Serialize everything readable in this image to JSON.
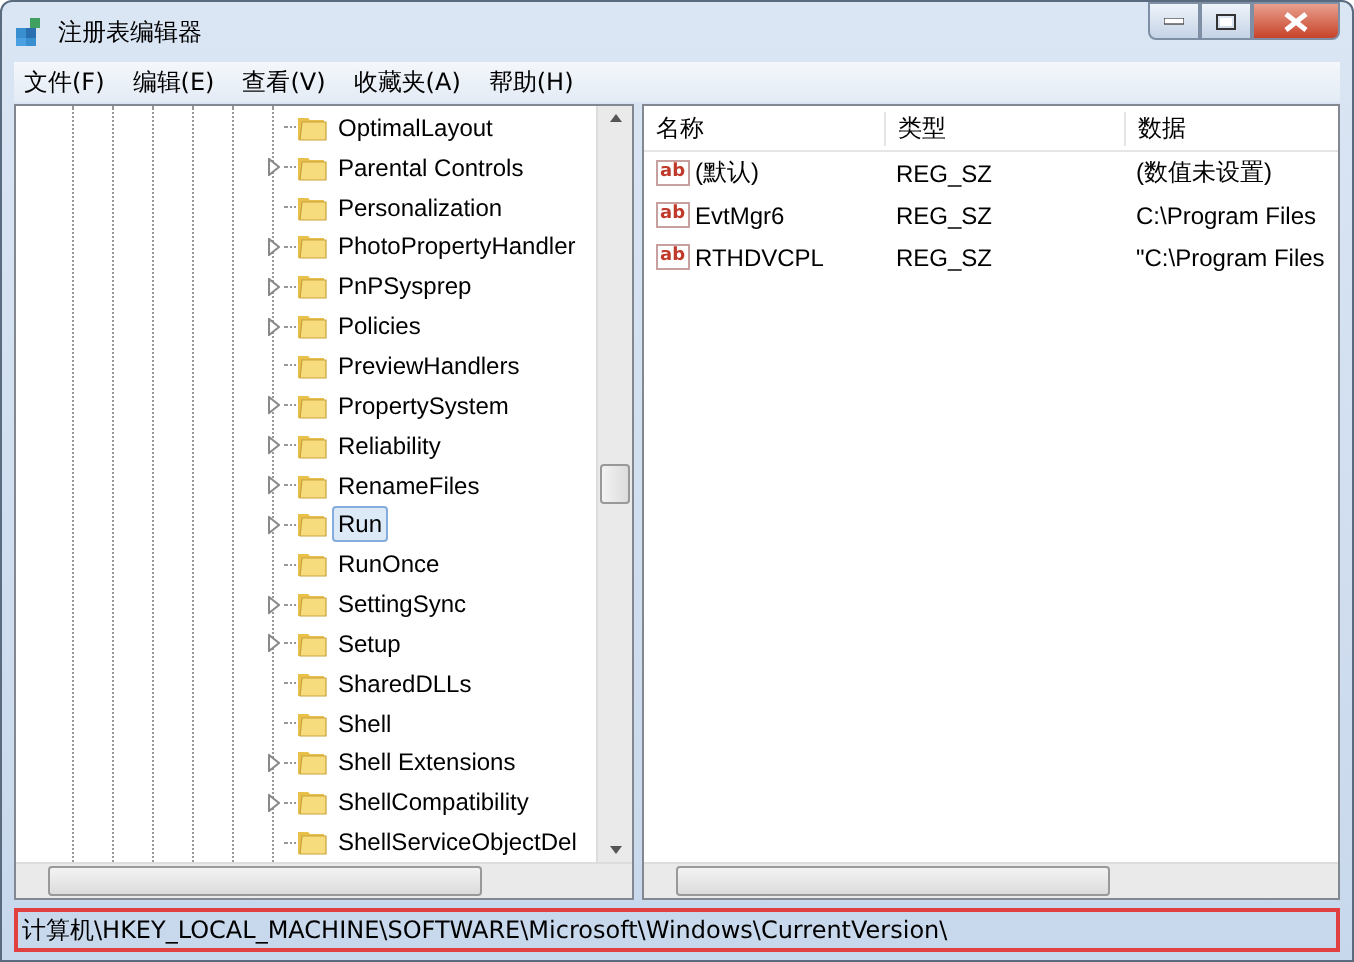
{
  "window": {
    "title": "注册表编辑器"
  },
  "menu": [
    "文件(F)",
    "编辑(E)",
    "查看(V)",
    "收藏夹(A)",
    "帮助(H)"
  ],
  "tree": {
    "items": [
      {
        "label": "OptimalLayout",
        "has_children": false,
        "selected": false
      },
      {
        "label": "Parental Controls",
        "has_children": true,
        "selected": false
      },
      {
        "label": "Personalization",
        "has_children": false,
        "selected": false
      },
      {
        "label": "PhotoPropertyHandler",
        "has_children": true,
        "selected": false
      },
      {
        "label": "PnPSysprep",
        "has_children": true,
        "selected": false
      },
      {
        "label": "Policies",
        "has_children": true,
        "selected": false
      },
      {
        "label": "PreviewHandlers",
        "has_children": false,
        "selected": false
      },
      {
        "label": "PropertySystem",
        "has_children": true,
        "selected": false
      },
      {
        "label": "Reliability",
        "has_children": true,
        "selected": false
      },
      {
        "label": "RenameFiles",
        "has_children": true,
        "selected": false
      },
      {
        "label": "Run",
        "has_children": true,
        "selected": true
      },
      {
        "label": "RunOnce",
        "has_children": false,
        "selected": false
      },
      {
        "label": "SettingSync",
        "has_children": true,
        "selected": false
      },
      {
        "label": "Setup",
        "has_children": true,
        "selected": false
      },
      {
        "label": "SharedDLLs",
        "has_children": false,
        "selected": false
      },
      {
        "label": "Shell",
        "has_children": false,
        "selected": false
      },
      {
        "label": "Shell Extensions",
        "has_children": true,
        "selected": false
      },
      {
        "label": "ShellCompatibility",
        "has_children": true,
        "selected": false
      },
      {
        "label": "ShellServiceObjectDel",
        "has_children": false,
        "selected": false
      }
    ]
  },
  "values": {
    "columns": [
      "名称",
      "类型",
      "数据"
    ],
    "rows": [
      {
        "icon_label": "ab",
        "name": "(默认)",
        "type": "REG_SZ",
        "data": "(数值未设置)"
      },
      {
        "icon_label": "ab",
        "name": "EvtMgr6",
        "type": "REG_SZ",
        "data": "C:\\Program Files"
      },
      {
        "icon_label": "ab",
        "name": "RTHDVCPL",
        "type": "REG_SZ",
        "data": "\"C:\\Program Files"
      }
    ]
  },
  "status_bar": {
    "path": "计算机\\HKEY_LOCAL_MACHINE\\SOFTWARE\\Microsoft\\Windows\\CurrentVersion\\",
    "highlighted": true
  }
}
